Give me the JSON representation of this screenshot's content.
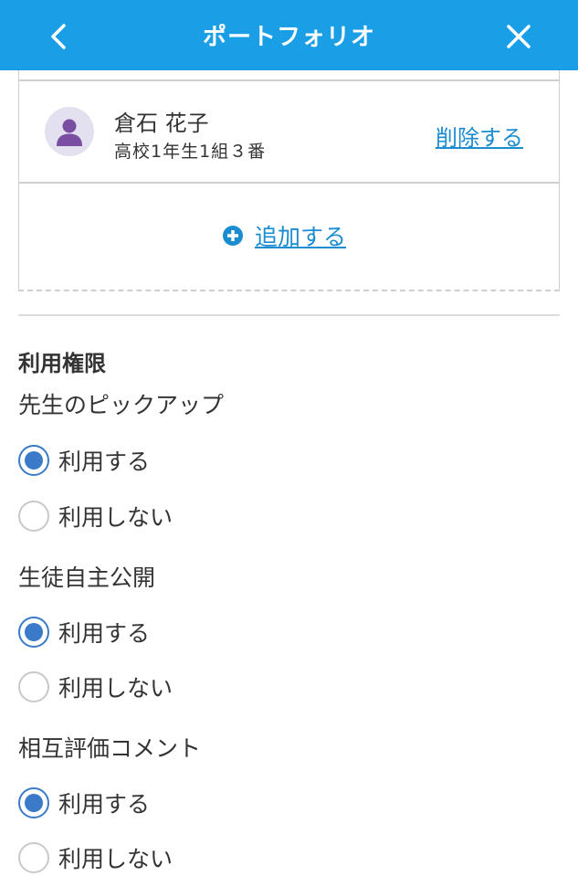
{
  "header": {
    "title": "ポートフォリオ",
    "background_color": "#1a9ee5",
    "back_icon": "chevron-left-icon",
    "close_icon": "close-icon"
  },
  "member": {
    "name": "倉石 花子",
    "class": "高校1年生1組３番",
    "delete_label": "削除する",
    "avatar_icon": "person-icon"
  },
  "add": {
    "label": "追加する",
    "icon": "plus-circle-icon"
  },
  "permissions": {
    "title": "利用権限",
    "groups": [
      {
        "label": "先生のピックアップ",
        "options": [
          {
            "label": "利用する",
            "checked": true
          },
          {
            "label": "利用しない",
            "checked": false
          }
        ]
      },
      {
        "label": "生徒自主公開",
        "options": [
          {
            "label": "利用する",
            "checked": true
          },
          {
            "label": "利用しない",
            "checked": false
          }
        ]
      },
      {
        "label": "相互評価コメント",
        "options": [
          {
            "label": "利用する",
            "checked": true
          },
          {
            "label": "利用しない",
            "checked": false
          }
        ]
      }
    ]
  },
  "colors": {
    "link": "#1a8ccf",
    "radio_selected": "#3a7ac8",
    "avatar": "#7a4fa3"
  }
}
